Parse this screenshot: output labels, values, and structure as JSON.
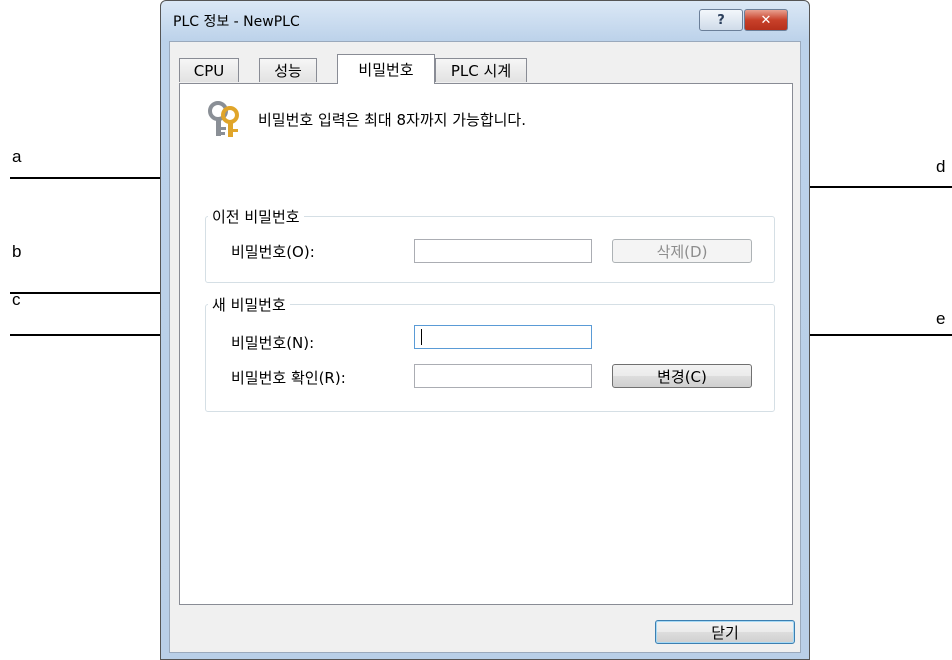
{
  "callouts": {
    "a": "a",
    "b": "b",
    "c": "c",
    "d": "d",
    "e": "e"
  },
  "window": {
    "title": "PLC 정보 - NewPLC",
    "help_glyph": "?",
    "close_glyph": "✕"
  },
  "tabs": [
    {
      "label": "CPU"
    },
    {
      "label": "성능"
    },
    {
      "label": "비밀번호"
    },
    {
      "label": "PLC 시계"
    }
  ],
  "password_tab": {
    "info_icon": "keys-icon",
    "info_text": "비밀번호 입력은 최대 8자까지 가능합니다.",
    "old_group": {
      "title": "이전 비밀번호",
      "password_label": "비밀번호(O):",
      "password_value": "",
      "delete_button": "삭제(D)"
    },
    "new_group": {
      "title": "새 비밀번호",
      "password_label": "비밀번호(N):",
      "password_value": "",
      "confirm_label": "비밀번호 확인(R):",
      "confirm_value": "",
      "change_button": "변경(C)"
    }
  },
  "footer": {
    "close_button": "닫기"
  }
}
